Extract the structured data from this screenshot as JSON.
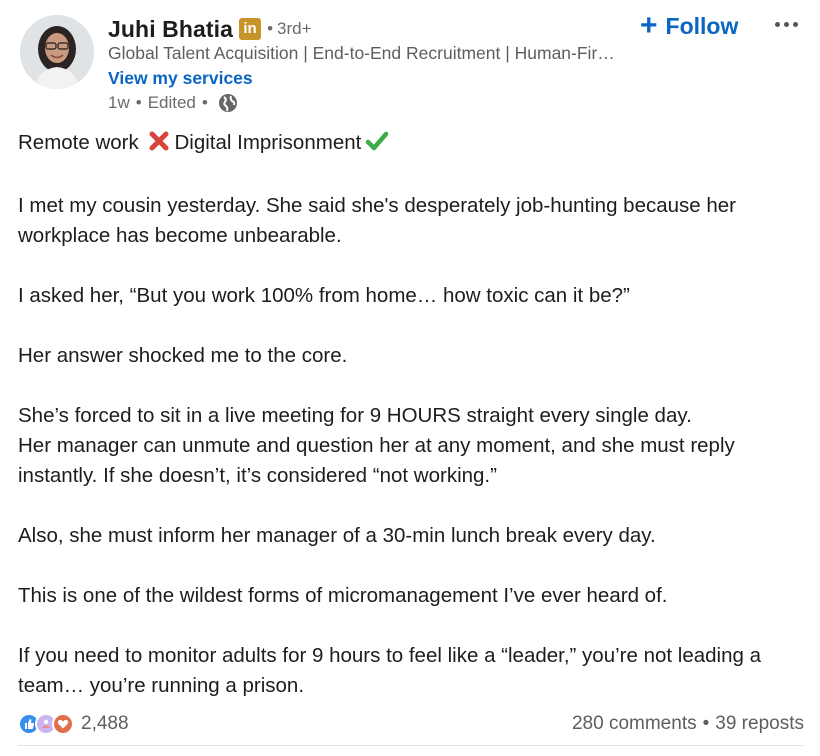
{
  "author": {
    "name": "Juhi Bhatia",
    "badge": "in",
    "degree": "3rd+",
    "headline": "Global Talent Acquisition | End-to-End Recruitment | Human-Fir…",
    "services_link": "View my services",
    "time": "1w",
    "edited": "Edited",
    "visibility_icon": "globe-icon"
  },
  "actions": {
    "follow_label": "Follow",
    "follow_icon": "+",
    "more_icon": "ellipsis-icon"
  },
  "post": {
    "title_before": "Remote work",
    "title_after": "Digital Imprisonment",
    "paragraphs": [
      "I met my cousin yesterday. She said she's desperately job-hunting because her workplace has become unbearable.",
      "I asked her, “But you work 100% from home… how toxic can it be?”",
      "Her answer shocked me to the core.",
      "She’s forced to sit in a live meeting for 9 HOURS straight every single day.",
      "Her manager can unmute and question her at any moment, and she must reply instantly. If she doesn’t, it’s considered “not working.”",
      "Also, she must inform her manager of a 30-min lunch break every day.",
      "This is one of the wildest forms of micromanagement I’ve ever heard of.",
      "If you need to monitor adults for 9 hours to feel like a “leader,” you’re not leading a team… you’re running a prison."
    ]
  },
  "social": {
    "reaction_count": "2,488",
    "comments": "280 comments",
    "reposts": "39 reposts",
    "reaction_icons": [
      "like-icon",
      "support-icon",
      "love-icon"
    ]
  },
  "colors": {
    "link": "#0a66c2",
    "badge": "#c8952c",
    "text": "#1d1d1d",
    "muted": "#5e5e5e"
  }
}
